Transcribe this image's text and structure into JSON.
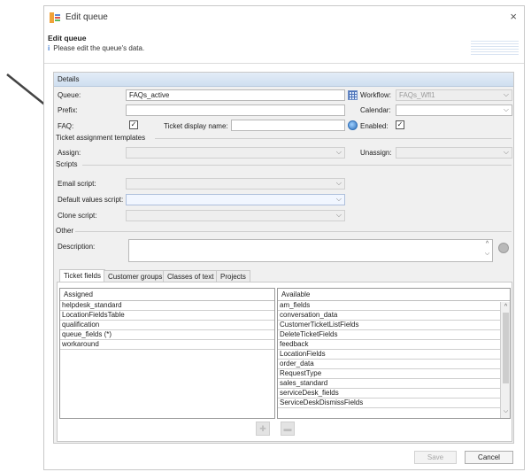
{
  "window": {
    "title": "Edit queue",
    "close_glyph": "×"
  },
  "header": {
    "title": "Edit queue",
    "info_glyph": "i",
    "subtitle": "Please edit the queue's data."
  },
  "details": {
    "section_label": "Details",
    "queue_label": "Queue:",
    "queue_value": "FAQs_active",
    "workflow_label": "Workflow:",
    "workflow_value": "FAQs_Wfl1",
    "prefix_label": "Prefix:",
    "prefix_value": "",
    "calendar_label": "Calendar:",
    "calendar_value": "",
    "faq_label": "FAQ:",
    "faq_checked": true,
    "ticket_display_name_label": "Ticket display name:",
    "ticket_display_name_value": "",
    "enabled_label": "Enabled:",
    "enabled_checked": true,
    "check_glyph": "✓",
    "chevron_glyph": "⌵"
  },
  "ticket_assignment": {
    "section_label": "Ticket assignment templates",
    "assign_label": "Assign:",
    "assign_value": "",
    "unassign_label": "Unassign:",
    "unassign_value": ""
  },
  "scripts": {
    "section_label": "Scripts",
    "email_label": "Email script:",
    "default_values_label": "Default values script:",
    "clone_label": "Clone script:"
  },
  "other": {
    "section_label": "Other",
    "description_label": "Description:",
    "description_value": "",
    "spin_up": "^",
    "spin_down": "⌵"
  },
  "tabs": [
    {
      "label": "Ticket fields",
      "active": true
    },
    {
      "label": "Customer groups",
      "active": false
    },
    {
      "label": "Classes of text",
      "active": false
    },
    {
      "label": "Projects",
      "active": false
    }
  ],
  "assigned": {
    "header": "Assigned",
    "items": [
      "helpdesk_standard",
      "LocationFieldsTable",
      "qualification",
      "queue_fields (*)",
      "workaround"
    ]
  },
  "available": {
    "header": "Available",
    "items": [
      "am_fields",
      "conversation_data",
      "CustomerTicketListFields",
      "DeleteTicketFields",
      "feedback",
      "LocationFields",
      "order_data",
      "RequestType",
      "sales_standard",
      "serviceDesk_fields",
      "ServiceDeskDismissFields"
    ],
    "scroll_up": "^",
    "scroll_down": "⌵"
  },
  "transfer": {
    "add_glyph": "✚",
    "remove_glyph": "▬"
  },
  "footer": {
    "save_label": "Save",
    "cancel_label": "Cancel"
  },
  "colors": {
    "accent": "#3a7bd5",
    "panel_header": "#cfdff0",
    "annotation_arrow": "#444444"
  },
  "icons": {
    "title": "queue-icon",
    "workflow": "grid-icon",
    "ticket_display_name": "globe-icon",
    "description_action": "circle-button-icon"
  }
}
